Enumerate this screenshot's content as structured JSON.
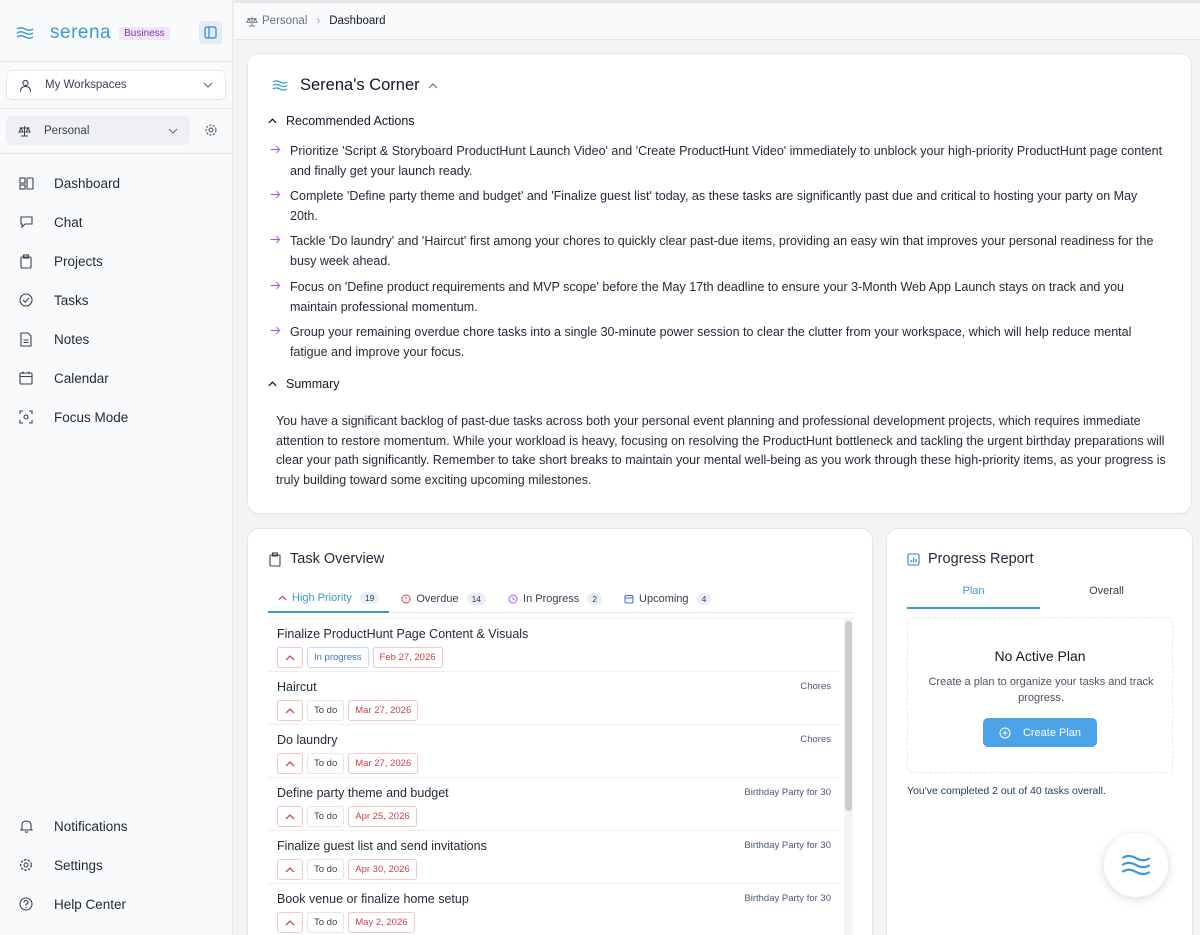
{
  "sidebar": {
    "brand": "serena",
    "badge": "Business",
    "workspace": "My Workspaces",
    "space": "Personal",
    "nav": [
      {
        "label": "Dashboard",
        "icon": "dashboard-icon"
      },
      {
        "label": "Chat",
        "icon": "chat-icon"
      },
      {
        "label": "Projects",
        "icon": "projects-icon"
      },
      {
        "label": "Tasks",
        "icon": "tasks-icon"
      },
      {
        "label": "Notes",
        "icon": "notes-icon"
      },
      {
        "label": "Calendar",
        "icon": "calendar-icon"
      },
      {
        "label": "Focus Mode",
        "icon": "focus-icon"
      }
    ],
    "bottom_nav": [
      {
        "label": "Notifications",
        "icon": "bell-icon"
      },
      {
        "label": "Settings",
        "icon": "gear-icon"
      },
      {
        "label": "Help Center",
        "icon": "help-icon"
      }
    ]
  },
  "breadcrumb": {
    "parent": "Personal",
    "current": "Dashboard"
  },
  "corner": {
    "title": "Serena's Corner",
    "actions_heading": "Recommended Actions",
    "actions": [
      "Prioritize 'Script & Storyboard ProductHunt Launch Video' and 'Create ProductHunt Video' immediately to unblock your high-priority ProductHunt page content and finally get your launch ready.",
      "Complete 'Define party theme and budget' and 'Finalize guest list' today, as these tasks are significantly past due and critical to hosting your party on May 20th.",
      "Tackle 'Do laundry' and 'Haircut' first among your chores to quickly clear past-due items, providing an easy win that improves your personal readiness for the busy week ahead.",
      "Focus on 'Define product requirements and MVP scope' before the May 17th deadline to ensure your 3-Month Web App Launch stays on track and you maintain professional momentum.",
      "Group your remaining overdue chore tasks into a single 30-minute power session to clear the clutter from your workspace, which will help reduce mental fatigue and improve your focus."
    ],
    "summary_heading": "Summary",
    "summary": "You have a significant backlog of past-due tasks across both your personal event planning and professional development projects, which requires immediate attention to restore momentum. While your workload is heavy, focusing on resolving the ProductHunt bottleneck and tackling the urgent birthday preparations will clear your path significantly. Remember to take short breaks to maintain your mental well-being as you work through these high-priority items, as your progress is truly building toward some exciting upcoming milestones."
  },
  "tasks": {
    "title": "Task Overview",
    "tabs": [
      {
        "label": "High Priority",
        "count": "19"
      },
      {
        "label": "Overdue",
        "count": "14"
      },
      {
        "label": "In Progress",
        "count": "2"
      },
      {
        "label": "Upcoming",
        "count": "4"
      }
    ],
    "rows": [
      {
        "title": "Finalize ProductHunt Page Content & Visuals",
        "status": "In progress",
        "due": "Feb 27, 2026",
        "project": ""
      },
      {
        "title": "Haircut",
        "status": "To do",
        "due": "Mar 27, 2026",
        "project": "Chores"
      },
      {
        "title": "Do laundry",
        "status": "To do",
        "due": "Mar 27, 2026",
        "project": "Chores"
      },
      {
        "title": "Define party theme and budget",
        "status": "To do",
        "due": "Apr 25, 2026",
        "project": "Birthday Party for 30"
      },
      {
        "title": "Finalize guest list and send invitations",
        "status": "To do",
        "due": "Apr 30, 2026",
        "project": "Birthday Party for 30"
      },
      {
        "title": "Book venue or finalize home setup",
        "status": "To do",
        "due": "May 2, 2026",
        "project": "Birthday Party for 30"
      }
    ]
  },
  "progress": {
    "title": "Progress Report",
    "tabs": [
      "Plan",
      "Overall"
    ],
    "empty_title": "No Active Plan",
    "empty_desc": "Create a plan to organize your tasks and track progress.",
    "create_label": "Create Plan",
    "completed_text": "You've completed 2 out of 40 tasks overall."
  },
  "colors": {
    "accent": "#3b9ad6",
    "arrow": "#a855f7",
    "badge": "#7e3ea8"
  }
}
